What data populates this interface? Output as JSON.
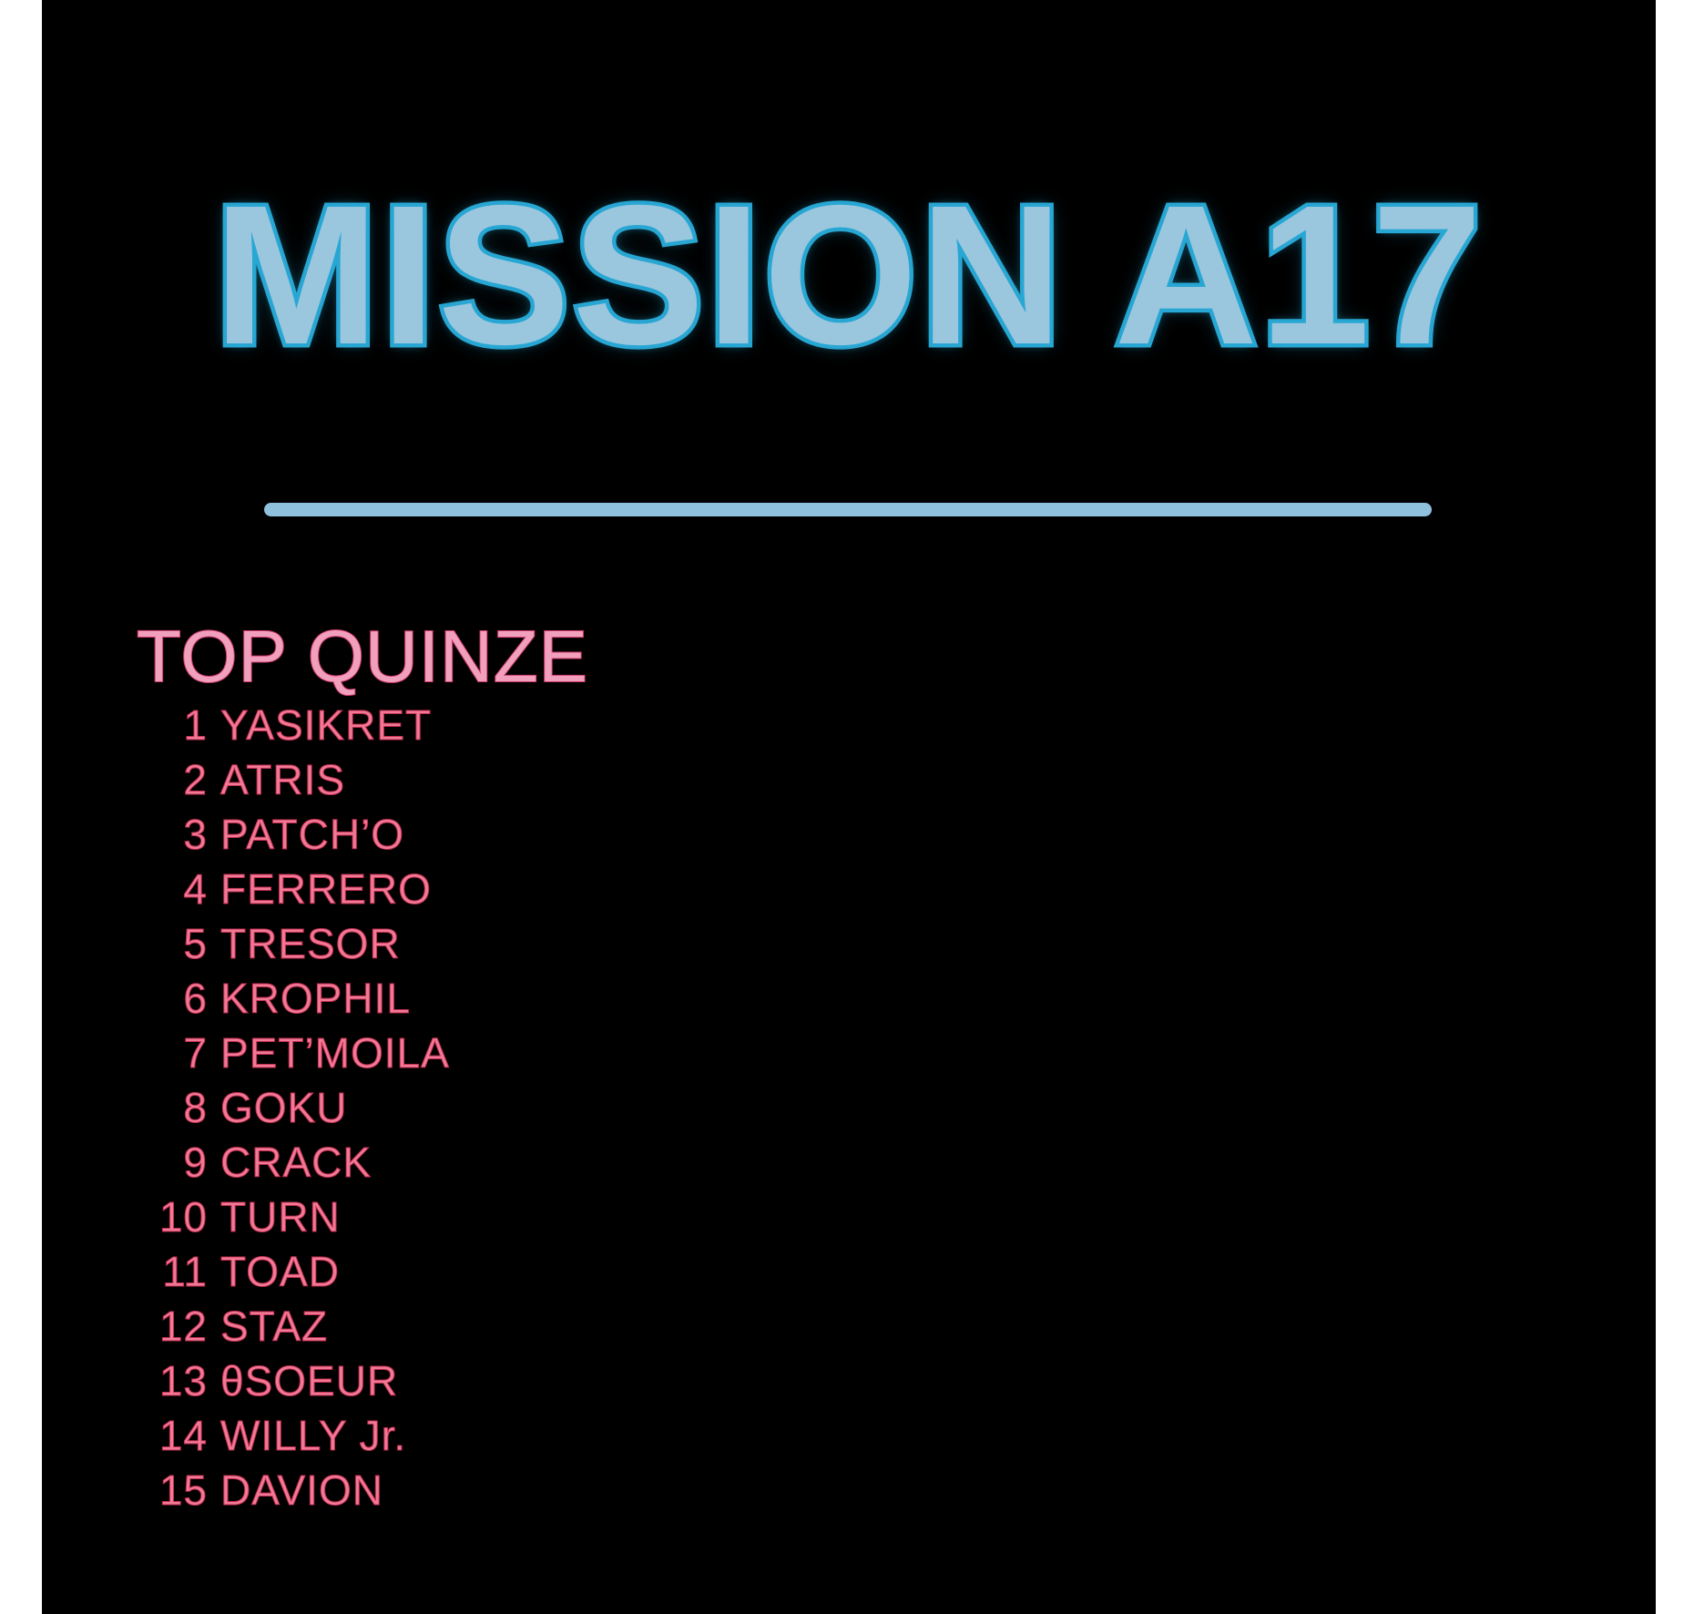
{
  "title": "MISSION A17",
  "list": {
    "heading": "TOP QUINZE",
    "entries": [
      {
        "rank": "1",
        "name": "YASIKRET"
      },
      {
        "rank": "2",
        "name": "ATRIS"
      },
      {
        "rank": "3",
        "name": "PATCH’O"
      },
      {
        "rank": "4",
        "name": "FERRERO"
      },
      {
        "rank": "5",
        "name": "TRESOR"
      },
      {
        "rank": "6",
        "name": "KROPHIL"
      },
      {
        "rank": "7",
        "name": "PET’MOILA"
      },
      {
        "rank": "8",
        "name": "GOKU"
      },
      {
        "rank": "9",
        "name": "CRACK"
      },
      {
        "rank": "10",
        "name": "TURN"
      },
      {
        "rank": "11",
        "name": "TOAD"
      },
      {
        "rank": "12",
        "name": "STAZ"
      },
      {
        "rank": "13",
        "name": "θSOEUR"
      },
      {
        "rank": "14",
        "name": "WILLY Jr."
      },
      {
        "rank": "15",
        "name": "DAVION"
      }
    ]
  },
  "colors": {
    "background": "#000000",
    "title_fill": "#9bc7de",
    "title_glow": "#2aa6d2",
    "divider": "#8fc1dc",
    "heading": "#f0a0bd",
    "entries": "#f07a94"
  }
}
